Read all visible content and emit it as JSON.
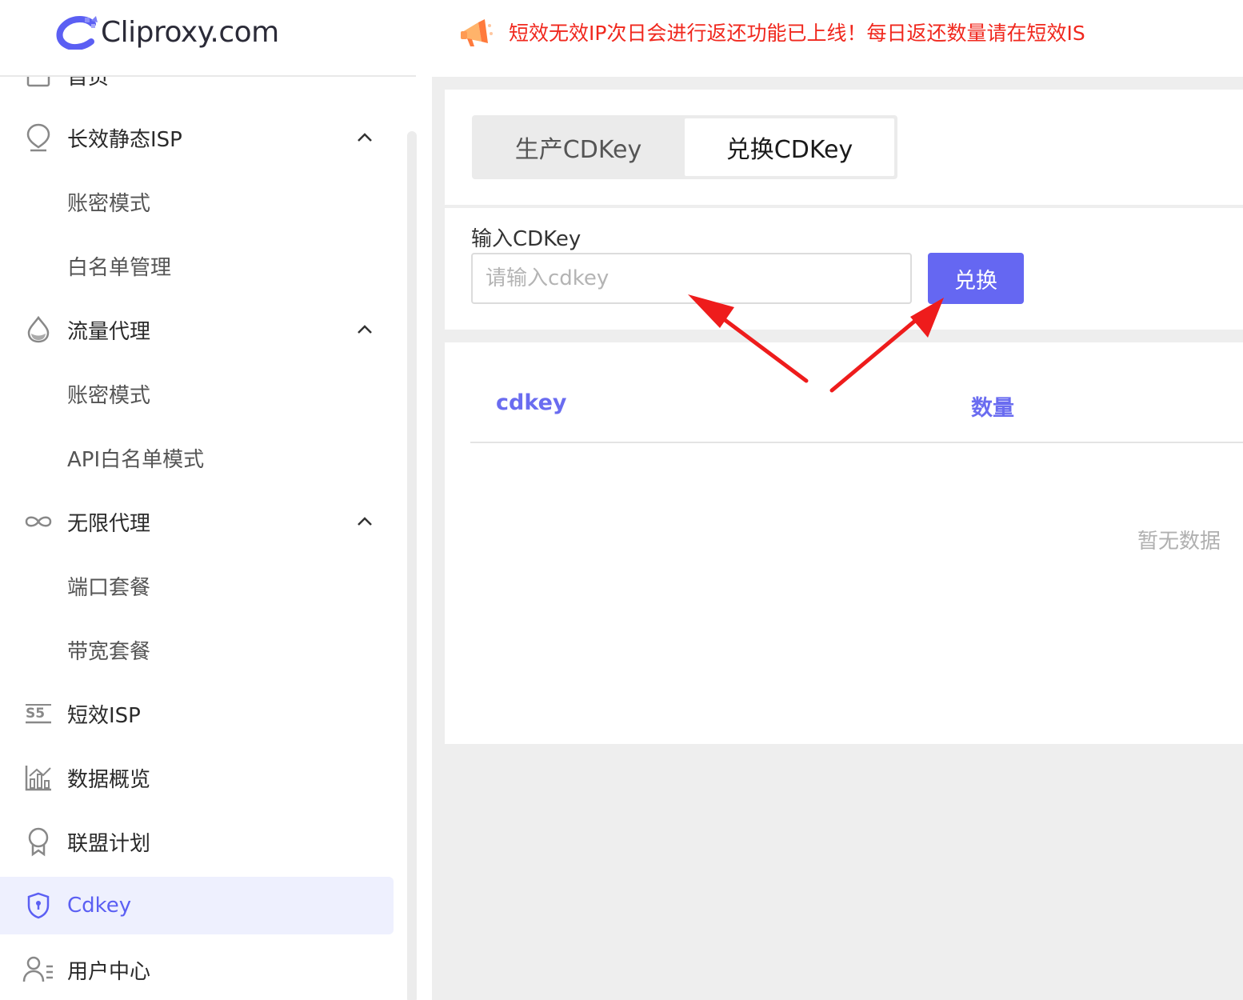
{
  "header": {
    "logo_text": "Cliproxy.com",
    "notice_text": "短效无效IP次日会进行返还功能已上线！每日返还数量请在短效IS"
  },
  "sidebar": {
    "items": [
      {
        "label": "首页",
        "icon": "home-icon"
      },
      {
        "label": "长效静态ISP",
        "icon": "location-pin-icon",
        "expanded": true
      },
      {
        "label": "账密模式"
      },
      {
        "label": "白名单管理"
      },
      {
        "label": "流量代理",
        "icon": "droplet-icon",
        "expanded": true
      },
      {
        "label": "账密模式"
      },
      {
        "label": "API白名单模式"
      },
      {
        "label": "无限代理",
        "icon": "infinity-icon",
        "expanded": true
      },
      {
        "label": "端口套餐"
      },
      {
        "label": "带宽套餐"
      },
      {
        "label": "短效ISP",
        "icon": "ss-icon"
      },
      {
        "label": "数据概览",
        "icon": "chart-icon"
      },
      {
        "label": "联盟计划",
        "icon": "award-icon"
      },
      {
        "label": "Cdkey",
        "icon": "shield-icon",
        "active": true
      },
      {
        "label": "用户中心",
        "icon": "user-icon"
      }
    ]
  },
  "main": {
    "tabs": [
      {
        "label": "生产CDKey",
        "active": false
      },
      {
        "label": "兑换CDKey",
        "active": true
      }
    ],
    "input_label": "输入CDKey",
    "input_placeholder": "请输入cdkey",
    "input_value": "",
    "redeem_button": "兑换",
    "table": {
      "columns": [
        "cdkey",
        "数量"
      ],
      "empty_text": "暂无数据"
    }
  },
  "colors": {
    "accent": "#6567f2",
    "notice": "#f0281e",
    "active_bg": "#eef0fe",
    "annotation_arrow": "#ee1c1c"
  }
}
